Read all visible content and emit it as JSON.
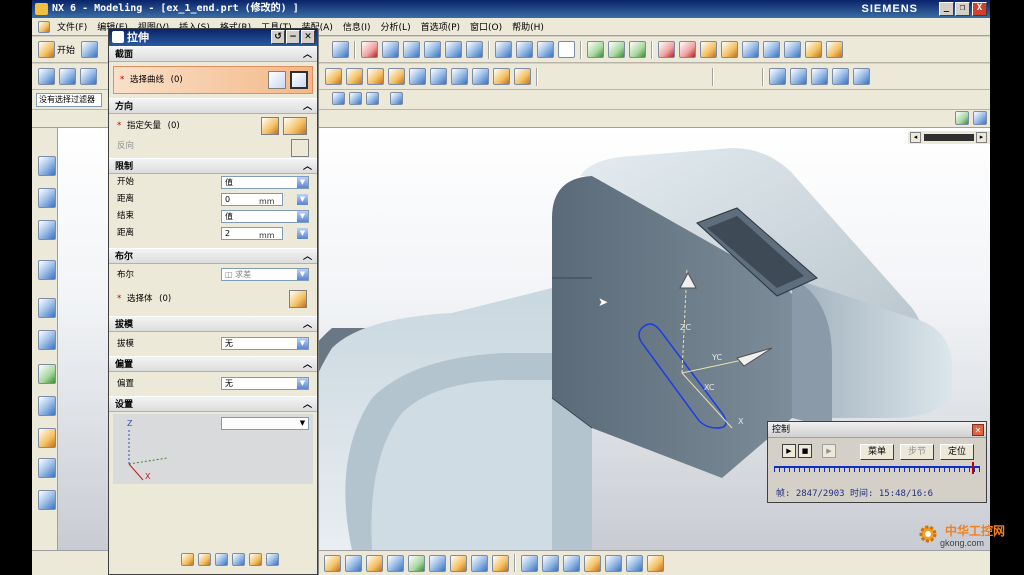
{
  "window": {
    "title": "NX 6 - Modeling - [ex_1_end.prt  (修改的) ]",
    "brand": "SIEMENS",
    "min": "_",
    "restore": "❐",
    "close": "X"
  },
  "menu": [
    "文件(F)",
    "编辑(E)",
    "视图(V)",
    "插入(S)",
    "格式(R)",
    "工具(T)",
    "装配(A)",
    "信息(I)",
    "分析(L)",
    "首选项(P)",
    "窗口(O)",
    "帮助(H)"
  ],
  "toolbar": {
    "start_label": "开始",
    "filter_value": "没有选择过滤器"
  },
  "extrude": {
    "title": "拉伸",
    "sections": {
      "section": {
        "header": "截面",
        "select_curve_label": "选择曲线",
        "select_curve_count": "(0)"
      },
      "direction": {
        "header": "方向",
        "vector_label": "指定矢量",
        "vector_count": "(0)",
        "reverse_label": "反向"
      },
      "limits": {
        "header": "限制",
        "start_label": "开始",
        "start_value": "值",
        "start_distance_label": "距离",
        "start_distance_value": "0",
        "end_label": "结束",
        "end_value": "值",
        "end_distance_label": "距离",
        "end_distance_value": "2",
        "unit": "mm"
      },
      "boolean": {
        "header": "布尔",
        "label": "布尔",
        "value": "求差",
        "select_body_label": "选择体",
        "select_body_count": "(0)"
      },
      "draft": {
        "header": "拔模",
        "label": "拔模",
        "value": "无"
      },
      "offset": {
        "header": "偏置",
        "label": "偏置",
        "value": "无"
      },
      "settings": {
        "header": "设置"
      }
    }
  },
  "viewport_labels": {
    "zc": "ZC",
    "yc": "YC",
    "xc": "XC",
    "x": "X",
    "triad_z": "Z",
    "triad_x": "X"
  },
  "control": {
    "title": "控制",
    "menu_label": "菜单",
    "step_label": "步节",
    "locate_label": "定位",
    "status": "帧: 2847/2903 时间: 15:48/16:6"
  },
  "watermark": {
    "cn": "中华工控网",
    "en": "gkong.com"
  }
}
